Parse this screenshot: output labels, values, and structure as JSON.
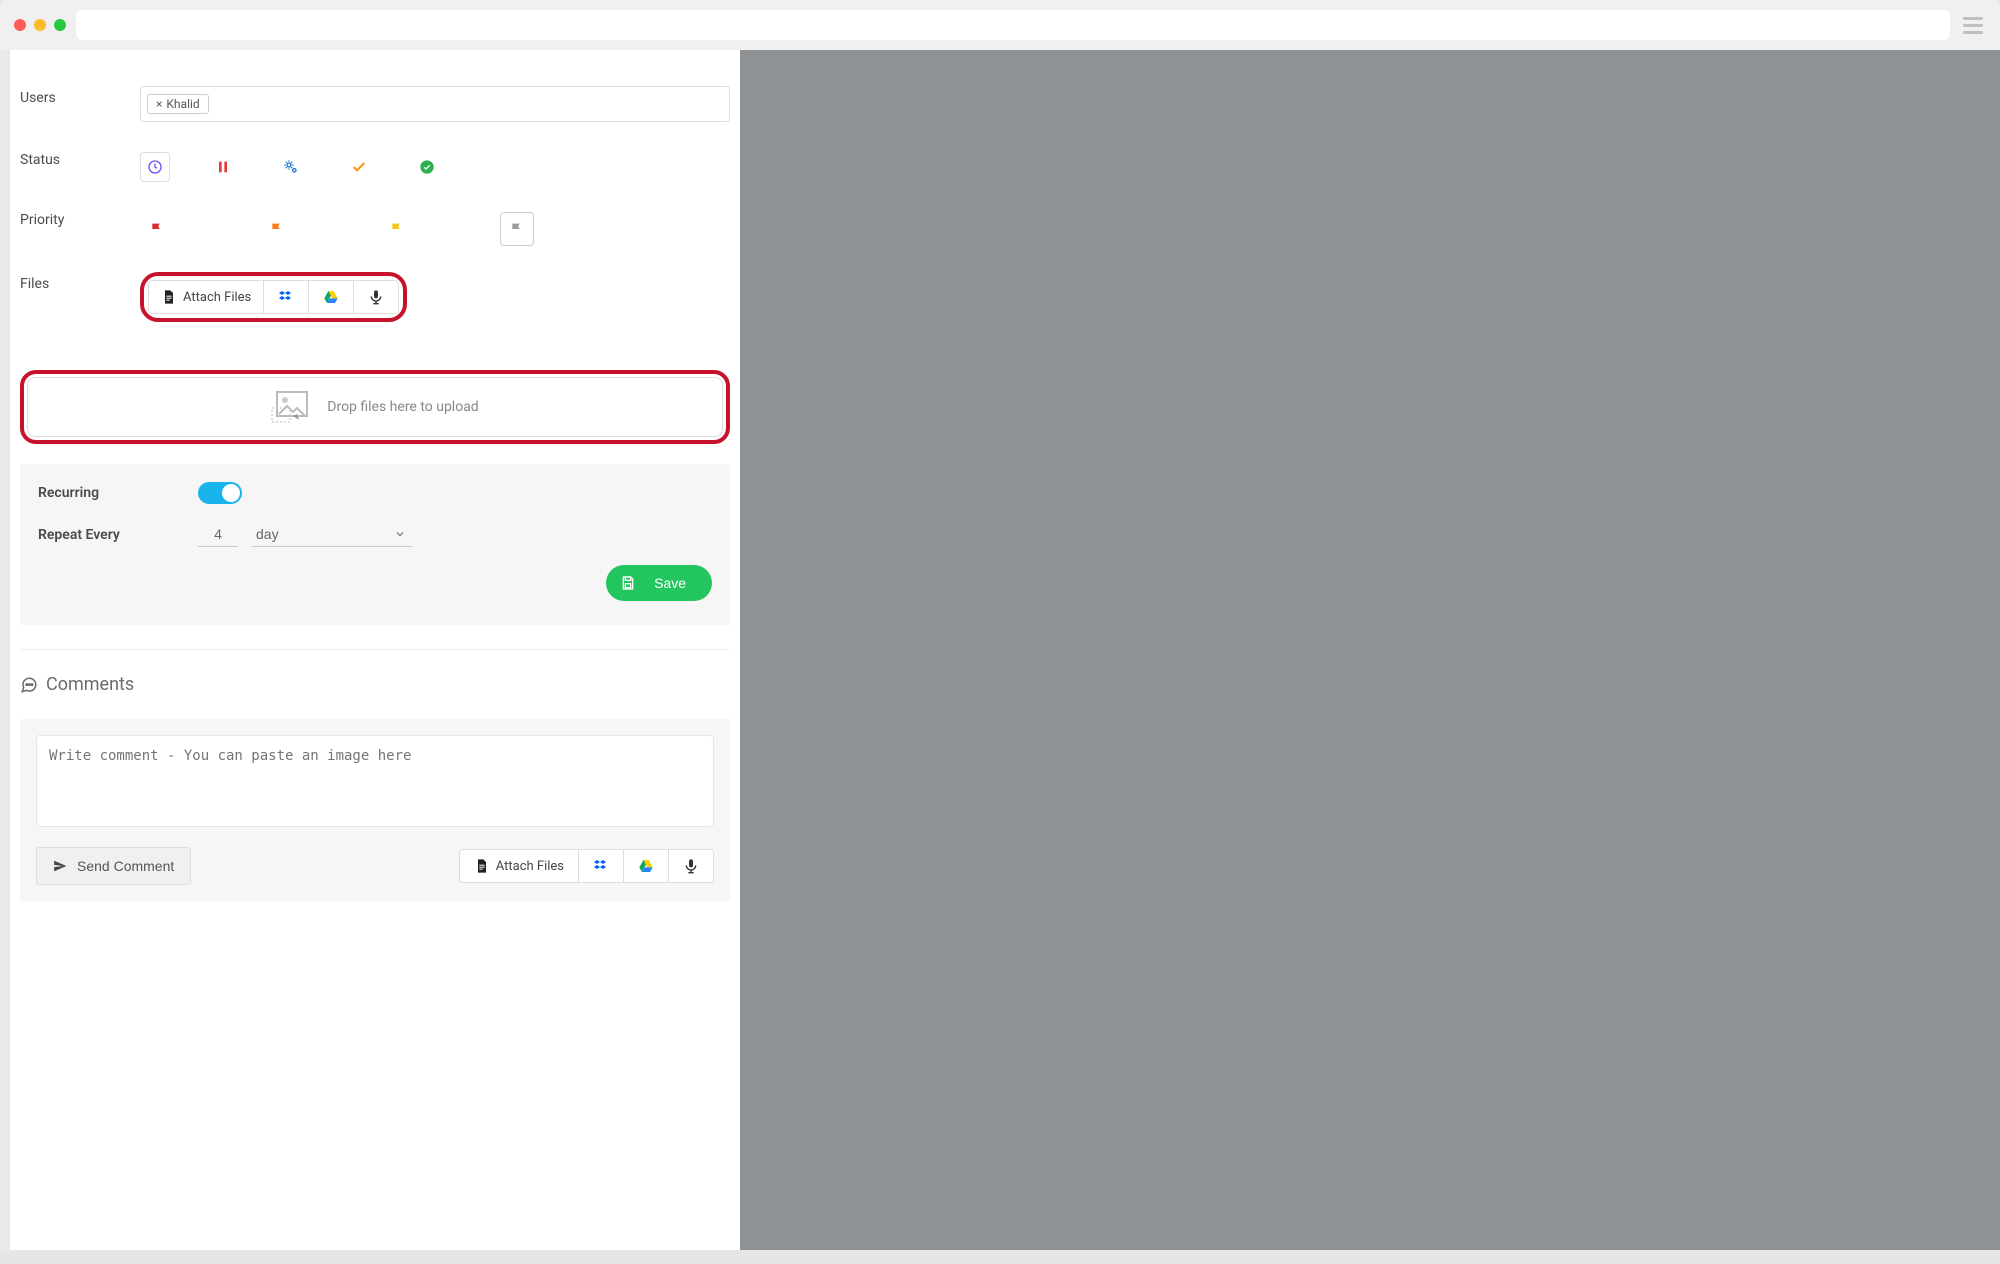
{
  "labels": {
    "users": "Users",
    "status": "Status",
    "priority": "Priority",
    "files": "Files",
    "recurring": "Recurring",
    "repeat_every": "Repeat Every",
    "comments": "Comments"
  },
  "users": {
    "tags": [
      {
        "label": "Khalid"
      }
    ]
  },
  "files": {
    "attach_label": "Attach Files",
    "dropzone_text": "Drop files here to upload"
  },
  "recurring": {
    "enabled": true,
    "repeat_value": "4",
    "repeat_unit": "day",
    "save_label": "Save"
  },
  "comments": {
    "placeholder": "Write comment - You can paste an image here",
    "send_label": "Send Comment",
    "attach_label": "Attach Files"
  }
}
